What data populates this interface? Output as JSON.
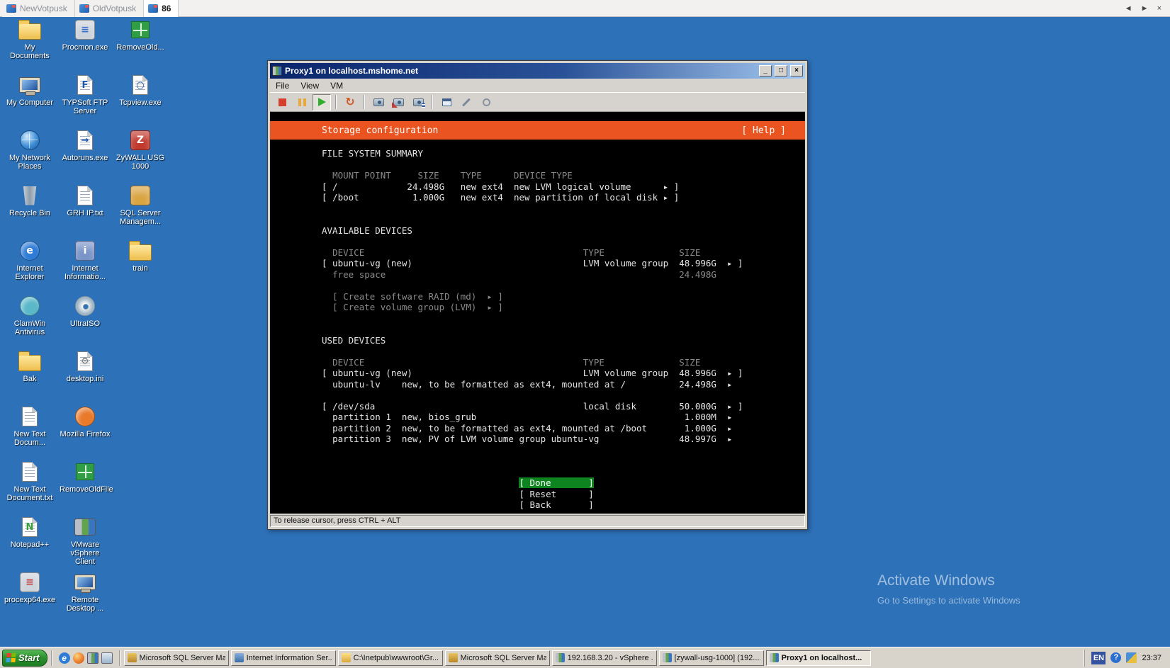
{
  "colors": {
    "desktop_blue": "#2d71b8",
    "header_orange": "#e95420",
    "done_green": "#0e8420"
  },
  "tabbar": {
    "tabs": [
      {
        "label": "NewVotpusk",
        "active": false
      },
      {
        "label": "OldVotpusk",
        "active": false
      },
      {
        "label": "86",
        "active": true
      }
    ],
    "controls": {
      "back": "◄",
      "forward": "►",
      "close": "×"
    }
  },
  "desktop": {
    "icons": [
      {
        "label": "My Documents",
        "art": "folder",
        "col": 0,
        "row": 0
      },
      {
        "label": "Procmon.exe",
        "art": "square",
        "bg": "#cdd3db",
        "ch": "≡",
        "chc": "#3a6fd0",
        "col": 1,
        "row": 0
      },
      {
        "label": "RemoveOld...",
        "art": "window",
        "col": 2,
        "row": 0
      },
      {
        "label": "My Computer",
        "art": "monitor",
        "col": 0,
        "row": 1
      },
      {
        "label": "TYPSoft FTP Server",
        "art": "page",
        "ch": "F",
        "chc": "#1a56b0",
        "col": 1,
        "row": 1
      },
      {
        "label": "Tcpview.exe",
        "art": "page",
        "ch": "○",
        "chc": "#2255aa",
        "col": 2,
        "row": 1
      },
      {
        "label": "My Network Places",
        "art": "globe",
        "col": 0,
        "row": 2
      },
      {
        "label": "Autoruns.exe",
        "art": "page",
        "ch": "→",
        "chc": "#1a56b0",
        "col": 1,
        "row": 2
      },
      {
        "label": "ZyWALL USG 1000",
        "art": "square",
        "bg": "#c03a2e",
        "ch": "Z",
        "chc": "#ffffff",
        "col": 2,
        "row": 2
      },
      {
        "label": "Recycle Bin",
        "art": "bin",
        "col": 0,
        "row": 3
      },
      {
        "label": "GRH IP.txt",
        "art": "page",
        "col": 1,
        "row": 3
      },
      {
        "label": "SQL Server Managem...",
        "art": "square",
        "bg": "#d9a441",
        "col": 2,
        "row": 3
      },
      {
        "label": "Internet Explorer",
        "art": "circle",
        "bg": "#2f7cd6",
        "ch": "e",
        "chc": "#ffffff",
        "col": 0,
        "row": 4
      },
      {
        "label": "Internet Informatio...",
        "art": "square",
        "bg": "#7a94c8",
        "ch": "i",
        "chc": "#ffffff",
        "col": 1,
        "row": 4
      },
      {
        "label": "train",
        "art": "folder",
        "col": 2,
        "row": 4
      },
      {
        "label": "ClamWin Antivirus",
        "art": "circle",
        "bg": "#5bb8c9",
        "col": 0,
        "row": 5
      },
      {
        "label": "UltraISO",
        "art": "disc",
        "col": 1,
        "row": 5
      },
      {
        "label": "Bak",
        "art": "folder",
        "col": 0,
        "row": 6
      },
      {
        "label": "desktop.ini",
        "art": "page",
        "ch": "⚙",
        "chc": "#777777",
        "col": 1,
        "row": 6
      },
      {
        "label": "New Text Docum...",
        "art": "page",
        "col": 0,
        "row": 7
      },
      {
        "label": "Mozilla Firefox",
        "art": "circle",
        "bg": "#e87a2a",
        "col": 1,
        "row": 7
      },
      {
        "label": "New Text Document.txt",
        "art": "page",
        "col": 0,
        "row": 8
      },
      {
        "label": "RemoveOldFile",
        "art": "window",
        "col": 1,
        "row": 8
      },
      {
        "label": "Notepad++",
        "art": "page",
        "ch": "N",
        "chc": "#3aa13a",
        "col": 0,
        "row": 9
      },
      {
        "label": "VMware vSphere Client",
        "art": "vmware",
        "col": 1,
        "row": 9
      },
      {
        "label": "procexp64.exe",
        "art": "square",
        "bg": "#cdd3db",
        "ch": "≡",
        "chc": "#c23b3b",
        "col": 0,
        "row": 10
      },
      {
        "label": "Remote Desktop ...",
        "art": "monitor",
        "col": 1,
        "row": 10
      }
    ]
  },
  "vm_window": {
    "title": "Proxy1 on localhost.mshome.net",
    "window_buttons": {
      "minimize": "_",
      "maximize": "□",
      "close": "×"
    },
    "menu": [
      "File",
      "View",
      "VM"
    ],
    "toolbar": [
      {
        "name": "power-off",
        "art": "stop"
      },
      {
        "name": "suspend",
        "art": "pause"
      },
      {
        "name": "power-on",
        "art": "play",
        "pressed": true
      },
      {
        "sep": true
      },
      {
        "name": "reset",
        "art": "reset",
        "glyph": "↻"
      },
      {
        "sep": true
      },
      {
        "name": "take-snapshot",
        "art": "snap"
      },
      {
        "name": "revert-snapshot",
        "art": "snapr"
      },
      {
        "name": "snapshot-manager",
        "art": "snapm"
      },
      {
        "sep": true
      },
      {
        "name": "open-console",
        "art": "console"
      },
      {
        "name": "edit-settings",
        "art": "wrench"
      },
      {
        "name": "install-tools",
        "art": "tools"
      }
    ],
    "console": {
      "header": {
        "title": "Storage configuration",
        "help": "[ Help ]"
      },
      "lines": [
        {
          "n": "section-title-file-system-summary",
          "c": "w",
          "s": [
            "FILE SYSTEM SUMMARY"
          ]
        },
        {
          "c": "w",
          "s": []
        },
        {
          "n": "fs-column-headers",
          "c": "d",
          "s": [
            2,
            "MOUNT POINT",
            5,
            "SIZE",
            4,
            "TYPE",
            6,
            "DEVICE TYPE"
          ]
        },
        {
          "n": "fs-row-root",
          "i": 1,
          "c": "w",
          "s": [
            "[ /",
            13,
            "24.498G",
            3,
            "new ext4",
            2,
            "new LVM logical volume",
            6,
            "▸ ]"
          ]
        },
        {
          "n": "fs-row-boot",
          "i": 1,
          "c": "w",
          "s": [
            "[ /boot",
            10,
            "1.000G",
            3,
            "new ext4",
            2,
            "new partition of local disk",
            1,
            "▸ ]"
          ]
        },
        {
          "c": "w",
          "s": []
        },
        {
          "c": "w",
          "s": []
        },
        {
          "n": "section-title-available-devices",
          "c": "w",
          "s": [
            "AVAILABLE DEVICES"
          ]
        },
        {
          "c": "w",
          "s": []
        },
        {
          "n": "available-column-headers",
          "c": "d",
          "s": [
            2,
            "DEVICE",
            41,
            "TYPE",
            14,
            "SIZE"
          ]
        },
        {
          "n": "available-row-ubuntu-vg",
          "i": 1,
          "c": "w",
          "s": [
            "[ ubuntu-vg (new)",
            32,
            "LVM volume group",
            2,
            "48.996G",
            2,
            "▸ ]"
          ]
        },
        {
          "n": "available-row-free-space",
          "c": "d",
          "s": [
            2,
            "free space",
            55,
            "24.498G"
          ]
        },
        {
          "c": "w",
          "s": []
        },
        {
          "n": "create-software-raid-option",
          "i": 1,
          "c": "d",
          "s": [
            2,
            "[ Create software RAID (md)  ▸ ]"
          ]
        },
        {
          "n": "create-volume-group-option",
          "i": 1,
          "c": "d",
          "s": [
            2,
            "[ Create volume group (LVM)  ▸ ]"
          ]
        },
        {
          "c": "w",
          "s": []
        },
        {
          "c": "w",
          "s": []
        },
        {
          "n": "section-title-used-devices",
          "c": "w",
          "s": [
            "USED DEVICES"
          ]
        },
        {
          "c": "w",
          "s": []
        },
        {
          "n": "used-column-headers",
          "c": "d",
          "s": [
            2,
            "DEVICE",
            41,
            "TYPE",
            14,
            "SIZE"
          ]
        },
        {
          "n": "used-row-ubuntu-vg",
          "i": 1,
          "c": "w",
          "s": [
            "[ ubuntu-vg (new)",
            32,
            "LVM volume group",
            2,
            "48.996G",
            2,
            "▸ ]"
          ]
        },
        {
          "n": "used-row-ubuntu-lv",
          "i": 1,
          "c": "w",
          "s": [
            2,
            "ubuntu-lv",
            4,
            "new, to be formatted as ext4, mounted at /",
            10,
            "24.498G",
            2,
            "▸"
          ]
        },
        {
          "c": "w",
          "s": []
        },
        {
          "n": "used-row-dev-sda",
          "i": 1,
          "c": "w",
          "s": [
            "[ /dev/sda",
            39,
            "local disk",
            8,
            "50.000G",
            2,
            "▸ ]"
          ]
        },
        {
          "n": "partition-1-row",
          "i": 1,
          "c": "w",
          "s": [
            2,
            "partition 1",
            2,
            "new, bios_grub",
            39,
            "1.000M",
            2,
            "▸"
          ]
        },
        {
          "n": "partition-2-row",
          "i": 1,
          "c": "w",
          "s": [
            2,
            "partition 2",
            2,
            "new, to be formatted as ext4, mounted at /boot",
            7,
            "1.000G",
            2,
            "▸"
          ]
        },
        {
          "n": "partition-3-row",
          "i": 1,
          "c": "w",
          "s": [
            2,
            "partition 3",
            2,
            "new, PV of LVM volume group ubuntu-vg",
            15,
            "48.997G",
            2,
            "▸"
          ]
        },
        {
          "c": "w",
          "s": []
        },
        {
          "c": "w",
          "s": []
        },
        {
          "c": "w",
          "s": []
        },
        {
          "n": "done-button",
          "i": 1,
          "c": "w",
          "s": [
            37,
            {
              "t": "[ Done       ]",
              "c": "g"
            }
          ]
        },
        {
          "n": "reset-button",
          "i": 1,
          "c": "w",
          "s": [
            37,
            "[ Reset      ]"
          ]
        },
        {
          "n": "back-button",
          "i": 1,
          "c": "w",
          "s": [
            37,
            "[ Back       ]"
          ]
        }
      ]
    },
    "statusbar": "To release cursor, press CTRL + ALT"
  },
  "taskbar": {
    "start": "Start",
    "quick_launch": [
      {
        "name": "internet-explorer",
        "art": "e",
        "ch": "e"
      },
      {
        "name": "firefox",
        "art": "fox"
      },
      {
        "name": "vsphere-client",
        "art": "vm"
      },
      {
        "name": "show-desktop",
        "art": "desk"
      }
    ],
    "buttons": [
      {
        "label": "Microsoft SQL Server Ma...",
        "icon": "gold"
      },
      {
        "label": "Internet Information Ser...",
        "icon": "blue"
      },
      {
        "label": "C:\\Inetpub\\wwwroot\\Gr...",
        "icon": "folder"
      },
      {
        "label": "Microsoft SQL Server Ma...",
        "icon": "gold"
      },
      {
        "label": "192.168.3.20 - vSphere ...",
        "icon": "vm"
      },
      {
        "label": "[zywall-usg-1000] (192....",
        "icon": "vm"
      },
      {
        "label": "Proxy1 on localhost...",
        "icon": "vm",
        "active": true
      }
    ],
    "tray": {
      "language": "EN",
      "help_glyph": "?",
      "time": "23:37"
    }
  },
  "watermark": {
    "line1": "Activate Windows",
    "line2": "Go to Settings to activate Windows"
  }
}
